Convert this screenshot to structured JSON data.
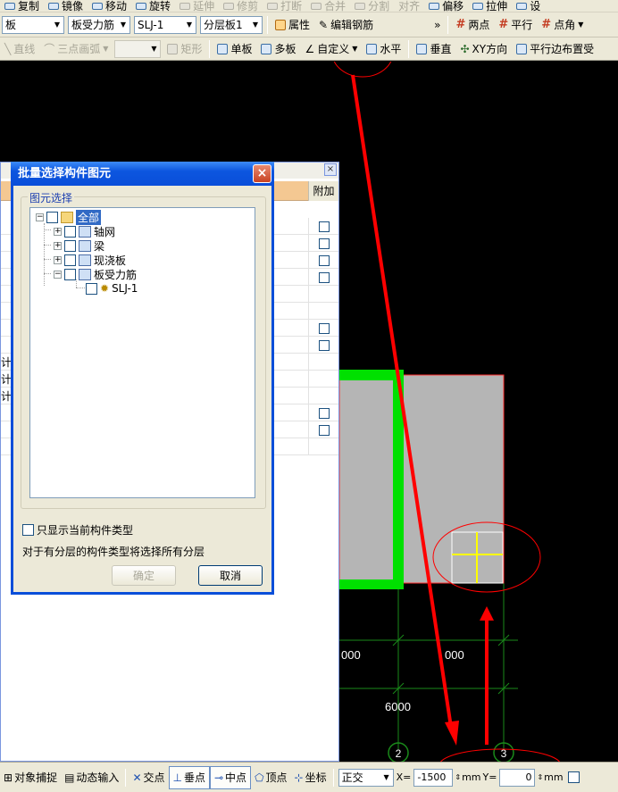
{
  "toolbar_top": {
    "items": [
      {
        "label": "复制",
        "disabled": false
      },
      {
        "label": "镜像",
        "disabled": false
      },
      {
        "label": "移动",
        "disabled": false
      },
      {
        "label": "旋转",
        "disabled": false
      },
      {
        "label": "延伸",
        "disabled": true
      },
      {
        "label": "修剪",
        "disabled": true
      },
      {
        "label": "打断",
        "disabled": true
      },
      {
        "label": "合并",
        "disabled": true
      },
      {
        "label": "分割",
        "disabled": true
      },
      {
        "label": "对齐",
        "disabled": true
      },
      {
        "label": "偏移",
        "disabled": false
      },
      {
        "label": "拉伸",
        "disabled": false
      },
      {
        "label": "设"
      }
    ]
  },
  "toolbar_row2": {
    "combo_component": "板",
    "combo_type": "板受力筋",
    "combo_name": "SLJ-1",
    "combo_layer": "分层板1",
    "properties": "属性",
    "edit_rebar": "编辑钢筋",
    "overflow": "»",
    "two_points": "两点",
    "parallel": "平行",
    "point_angle": "点角"
  },
  "toolbar_row3": {
    "line": "直线",
    "arc": "三点画弧",
    "rect": "矩形",
    "single_slab": "单板",
    "multi_slab": "多板",
    "custom": "自定义",
    "horizontal": "水平",
    "vertical": "垂直",
    "xy_direction": "XY方向",
    "parallel_edge": "平行边布置受"
  },
  "canvas": {
    "dim_left": "000",
    "dim_mid": "000",
    "dim_bottom": "6000",
    "axis_2": "2",
    "axis_3": "3"
  },
  "side_panel": {
    "close": "×",
    "attach_header": "附加",
    "text_1": "计",
    "text_2": "计",
    "text_3": "计"
  },
  "dialog": {
    "title": "批量选择构件图元",
    "close": "×",
    "group_label": "图元选择",
    "tree": {
      "root": "全部",
      "axis_grid": "轴网",
      "beam": "梁",
      "cast_slab": "现浇板",
      "slab_rebar": "板受力筋",
      "leaf": "SLJ-1"
    },
    "only_current": "只显示当前构件类型",
    "note": "对于有分层的构件类型将选择所有分层",
    "ok": "确定",
    "cancel": "取消"
  },
  "statusbar": {
    "snap": "对象捕捉",
    "dynamic_input": "动态输入",
    "intersection": "交点",
    "perpendicular": "垂点",
    "midpoint": "中点",
    "vertex": "顶点",
    "coordinate": "坐标",
    "ortho": "正交",
    "x_label": "X=",
    "x_value": "-1500",
    "unit_mm": "mm",
    "y_label": "Y=",
    "y_value": "0"
  },
  "colors": {
    "annotation_red": "#ff0000",
    "slab_fill": "#b5b5b5",
    "beam_green": "#00e000",
    "axis_line_green": "#1a8a1a"
  }
}
